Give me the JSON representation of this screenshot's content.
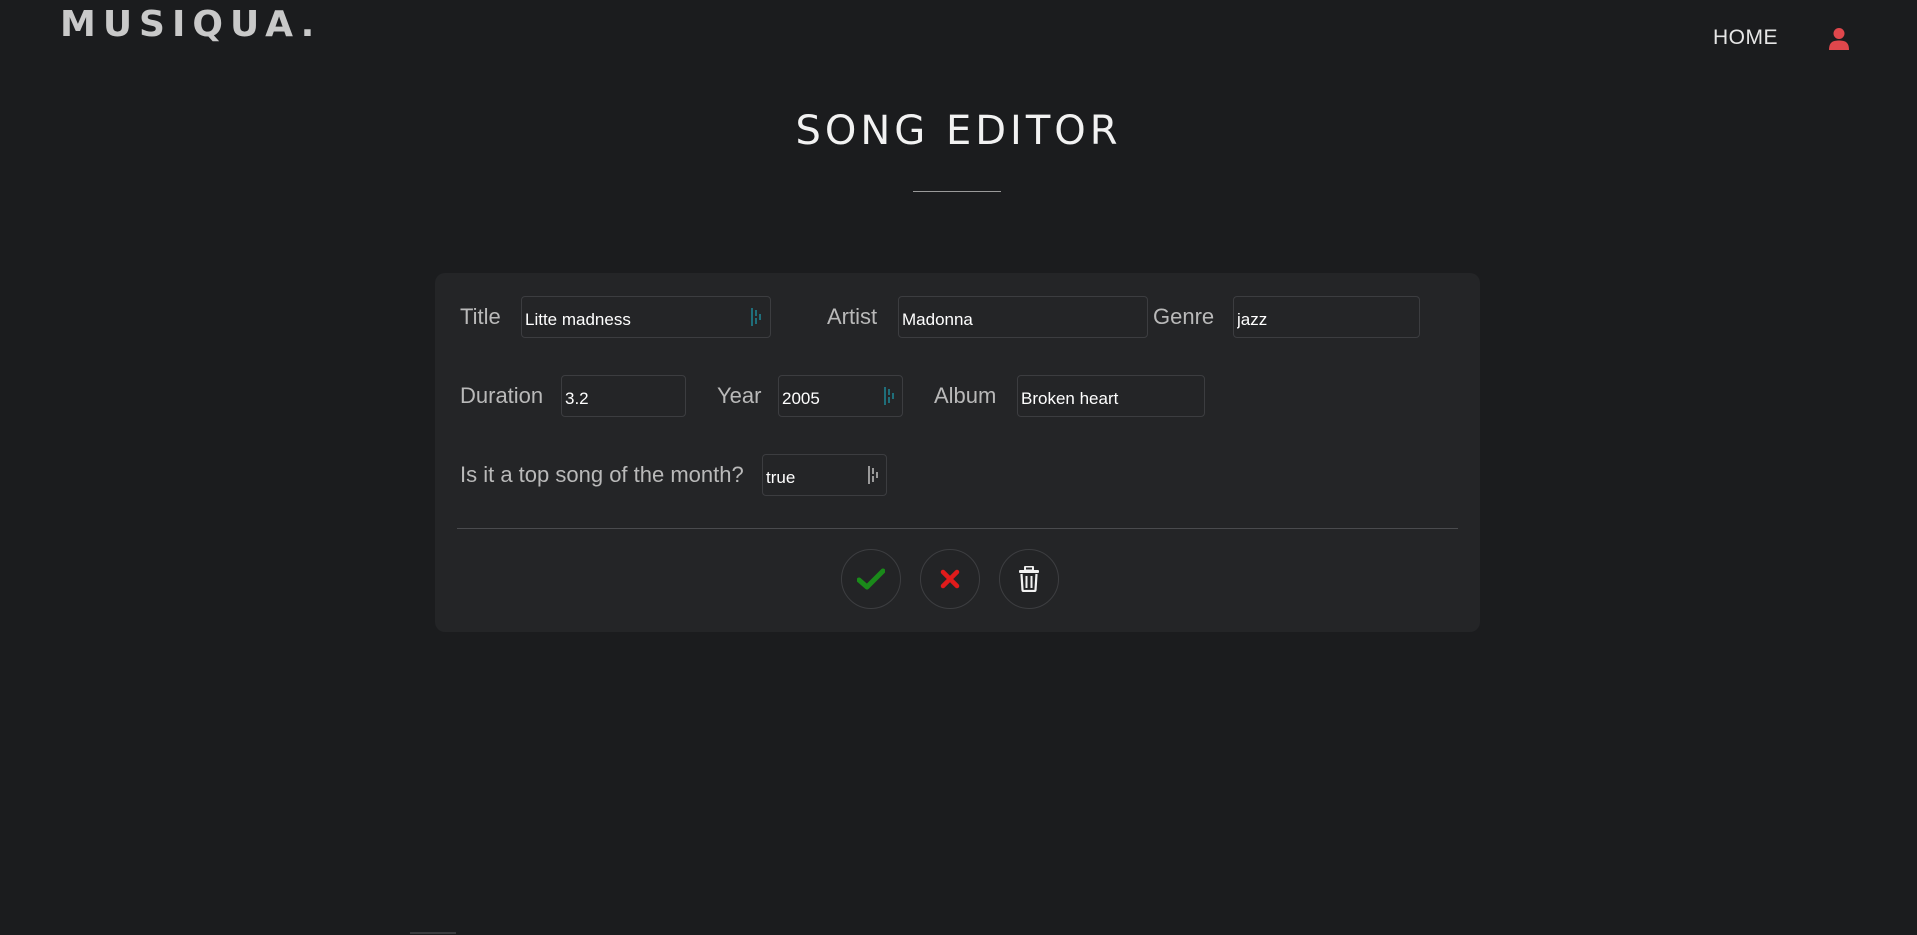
{
  "brand": {
    "name": "MUSIQUA."
  },
  "nav": {
    "home_label": "HOME",
    "user_icon": "user-icon"
  },
  "page": {
    "title": "SONG EDITOR"
  },
  "form": {
    "title": {
      "label": "Title",
      "value": "Litte madness"
    },
    "artist": {
      "label": "Artist",
      "value": "Madonna"
    },
    "genre": {
      "label": "Genre",
      "value": "jazz"
    },
    "duration": {
      "label": "Duration",
      "value": "3.2"
    },
    "year": {
      "label": "Year",
      "value": "2005"
    },
    "album": {
      "label": "Album",
      "value": "Broken heart"
    },
    "top_song": {
      "label": "Is it a top song of the month?",
      "value": "true"
    }
  },
  "actions": {
    "save_icon": "check-icon",
    "cancel_icon": "close-icon",
    "delete_icon": "trash-icon"
  },
  "colors": {
    "background": "#1b1c1e",
    "card": "#242527",
    "accent_user": "#e0474c",
    "save": "#1a8a1a",
    "cancel": "#e01b1b",
    "spinner": "#1f6e7a"
  }
}
